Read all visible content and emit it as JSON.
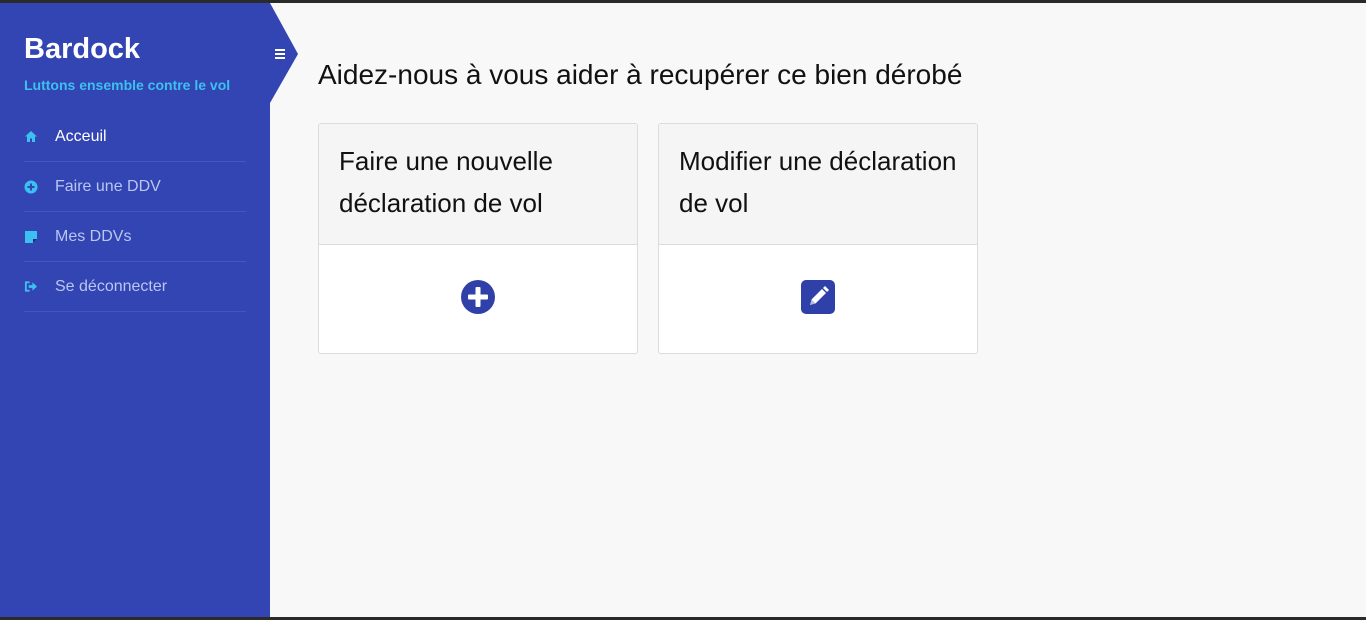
{
  "sidebar": {
    "brand": "Bardock",
    "tagline": "Luttons ensemble contre le vol",
    "items": [
      {
        "label": "Acceuil",
        "icon": "home-icon",
        "active": true
      },
      {
        "label": "Faire une DDV",
        "icon": "plus-circle-icon",
        "active": false
      },
      {
        "label": "Mes DDVs",
        "icon": "sticky-note-icon",
        "active": false
      },
      {
        "label": "Se déconnecter",
        "icon": "sign-out-icon",
        "active": false
      }
    ],
    "toggle_icon": "hamburger-menu-icon"
  },
  "main": {
    "title": "Aidez-nous à vous aider à recupérer ce bien dérobé",
    "cards": [
      {
        "title": "Faire une nouvelle déclaration de vol",
        "icon": "plus-circle-icon"
      },
      {
        "title": "Modifier une déclaration de vol",
        "icon": "pencil-square-icon"
      }
    ]
  },
  "colors": {
    "sidebar_bg": "#3344b3",
    "accent": "#3cc0f0",
    "icon_blue": "#2f40a8"
  }
}
